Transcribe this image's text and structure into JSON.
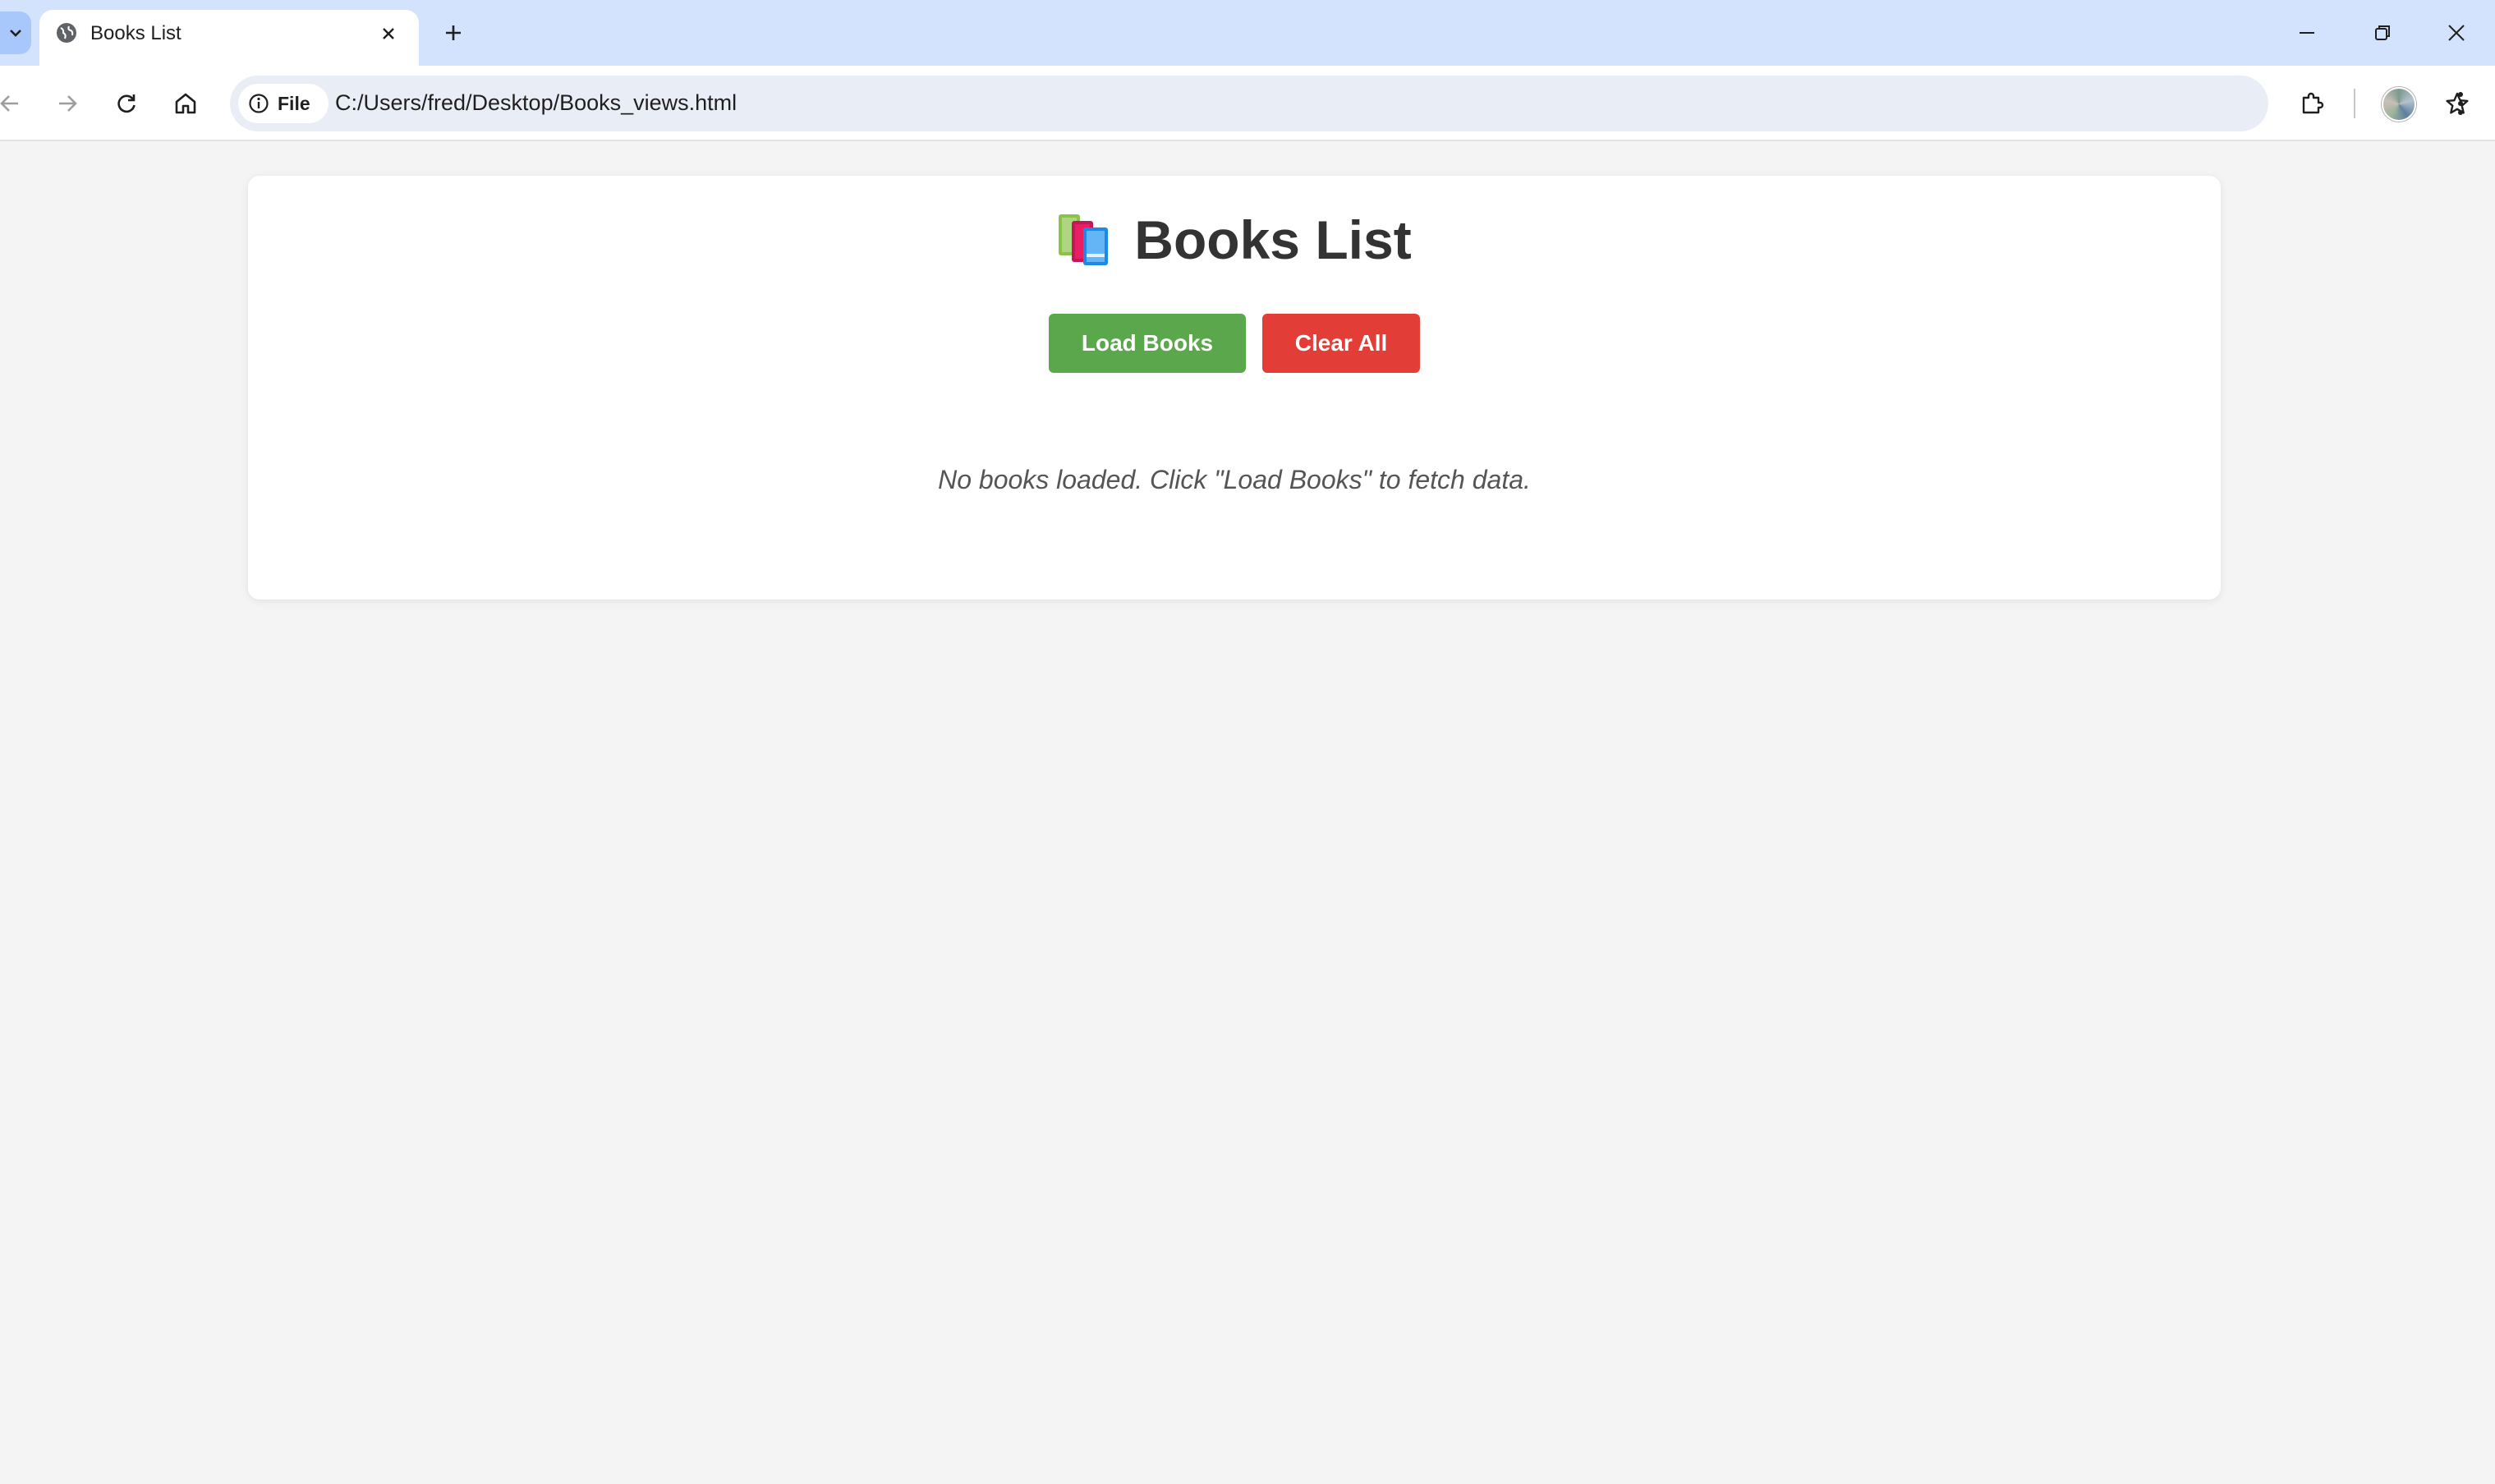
{
  "browser": {
    "tab": {
      "title": "Books List"
    },
    "address_bar": {
      "site_chip_label": "File",
      "url": "C:/Users/fred/Desktop/Books_views.html"
    }
  },
  "page": {
    "heading": "Books List",
    "buttons": {
      "load_label": "Load Books",
      "clear_label": "Clear All"
    },
    "empty_message": "No books loaded. Click \"Load Books\" to fetch data.",
    "colors": {
      "load_button": "#5aa84b",
      "clear_button": "#e23d36",
      "heading_text": "#333333",
      "message_text": "#555555"
    }
  },
  "icons": {
    "tab_search": "chevron-down-icon",
    "favicon": "globe-icon",
    "tab_close": "close-icon",
    "new_tab": "plus-icon",
    "back": "arrow-left-icon",
    "forward": "arrow-right-icon",
    "reload": "reload-icon",
    "home": "home-icon",
    "site_info": "info-icon",
    "bookmark": "star-icon",
    "extensions": "puzzle-icon",
    "menu": "kebab-menu-icon",
    "heading_emoji": "books-icon"
  }
}
